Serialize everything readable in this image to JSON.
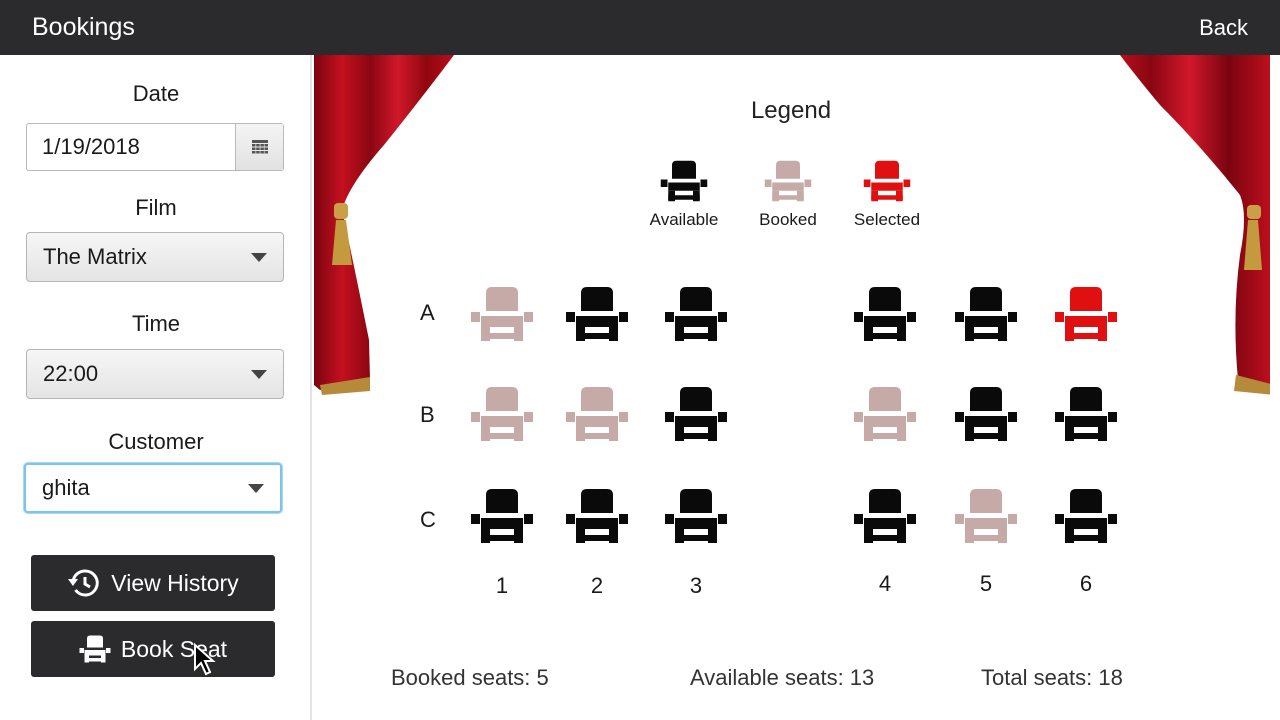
{
  "topbar": {
    "title": "Bookings",
    "back_label": "Back"
  },
  "sidebar": {
    "date_label": "Date",
    "date_value": "1/19/2018",
    "film_label": "Film",
    "film_value": "The Matrix",
    "time_label": "Time",
    "time_value": "22:00",
    "customer_label": "Customer",
    "customer_value": "ghita",
    "view_history_label": "View History",
    "book_seat_label": "Book Seat"
  },
  "legend": {
    "title": "Legend",
    "items": [
      {
        "label": "Available",
        "status": "available"
      },
      {
        "label": "Booked",
        "status": "booked"
      },
      {
        "label": "Selected",
        "status": "selected"
      }
    ]
  },
  "seat_colors": {
    "available": "#0a0a0a",
    "booked": "#c5aaa8",
    "selected": "#e01010"
  },
  "rows": [
    "A",
    "B",
    "C"
  ],
  "columns": [
    "1",
    "2",
    "3",
    "4",
    "5",
    "6"
  ],
  "seats": {
    "A": [
      "booked",
      "available",
      "available",
      "available",
      "available",
      "selected"
    ],
    "B": [
      "booked",
      "booked",
      "available",
      "booked",
      "available",
      "available"
    ],
    "C": [
      "available",
      "available",
      "available",
      "available",
      "booked",
      "available"
    ]
  },
  "stats": {
    "booked": "Booked seats: 5",
    "available": "Available seats: 13",
    "total": "Total seats: 18"
  }
}
